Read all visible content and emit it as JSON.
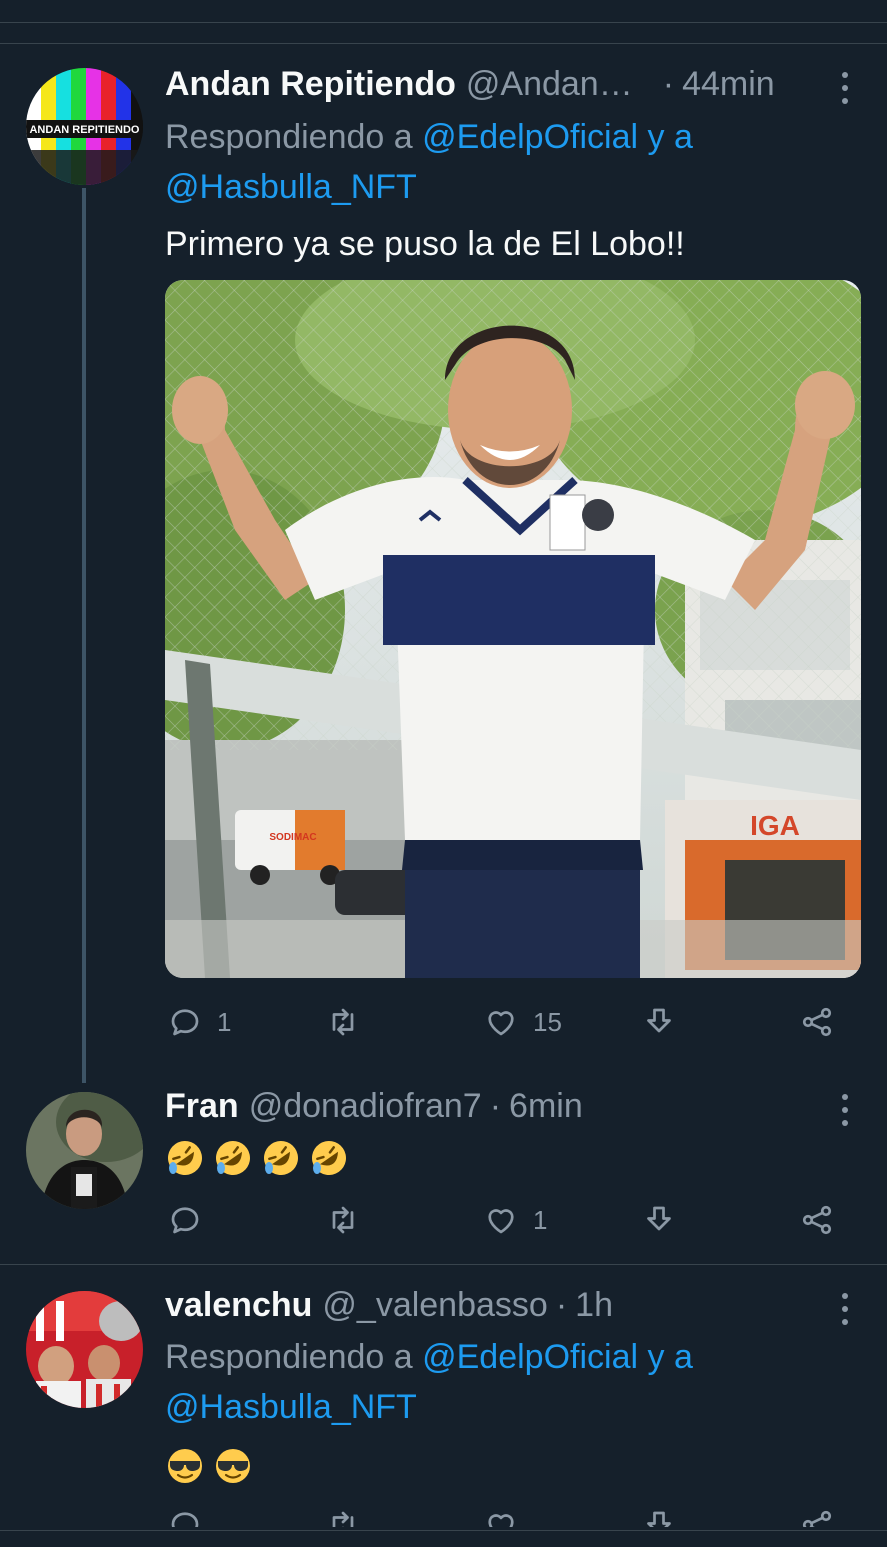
{
  "tweets": [
    {
      "name": "Andan Repitiendo",
      "handle": "@Andan…",
      "separator": "·",
      "time": "44min",
      "replying_prefix": "Respondiendo a",
      "replying_user1": "@EdelpOficial",
      "replying_join": "y a",
      "replying_user2": "@Hasbulla_NFT",
      "text": "Primero ya se puso la de El Lobo!!",
      "avatar_text": "ANDAN REPITIENDO",
      "media_sign": "IGA",
      "media_van_text": "SODIMAC",
      "replies": "1",
      "likes": "15"
    },
    {
      "name": "Fran",
      "handle": "@donadiofran7",
      "separator": "·",
      "time": "6min",
      "emojis": [
        "rolling-on-floor-laughing",
        "rolling-on-floor-laughing",
        "rolling-on-floor-laughing",
        "rolling-on-floor-laughing"
      ],
      "replies": "",
      "likes": "1"
    },
    {
      "name": "valenchu",
      "handle": "@_valenbasso",
      "separator": "·",
      "time": "1h",
      "replying_prefix": "Respondiendo a",
      "replying_user1": "@EdelpOficial",
      "replying_join": "y a",
      "replying_user2": "@Hasbulla_NFT",
      "emojis": [
        "smiling-face-with-sunglasses",
        "smiling-face-with-sunglasses"
      ]
    }
  ],
  "colors": {
    "background": "#15202b",
    "text": "#f7f9f9",
    "muted": "#8b98a5",
    "accent": "#1d9bf0",
    "divider": "#38444d"
  }
}
